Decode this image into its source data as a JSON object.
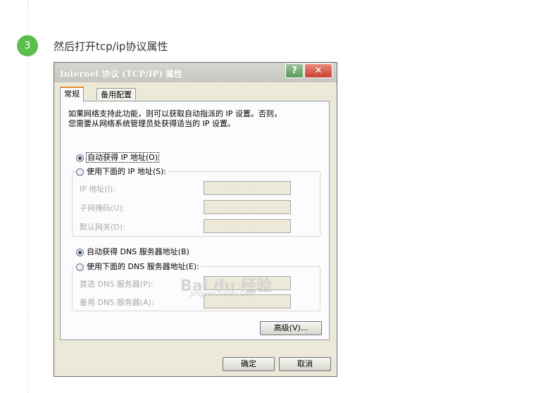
{
  "step": {
    "number": "3",
    "text": "然后打开tcp/ip协议属性"
  },
  "dialog": {
    "title": "Internet 协议 (TCP/IP) 属性",
    "help_btn": "?",
    "close_btn": "✕",
    "tabs": [
      {
        "label": "常规"
      },
      {
        "label": "备用配置"
      }
    ],
    "description_line1": "如果网络支持此功能，则可以获取自动指派的 IP 设置。否则，",
    "description_line2": "您需要从网络系统管理员处获得适当的 IP 设置。",
    "auto_ip": "自动获得 IP 地址(O)",
    "manual_ip": "使用下面的 IP 地址(S):",
    "ip_address_label": "IP 地址(I):",
    "subnet_label": "子网掩码(U):",
    "gateway_label": "默认网关(D):",
    "auto_dns": "自动获得 DNS 服务器地址(B)",
    "manual_dns": "使用下面的 DNS 服务器地址(E):",
    "preferred_dns_label": "首选 DNS 服务器(P):",
    "alternate_dns_label": "备用 DNS 服务器(A):",
    "advanced_btn": "高级(V)...",
    "ok_btn": "确定",
    "cancel_btn": "取消"
  },
  "watermark": {
    "logo": "Bai du 经验",
    "url": "jingyan.baidu.com"
  },
  "colors": {
    "step_circle": "#5bbd4b",
    "dialog_bg": "#ece9d8",
    "tab_accent": "#e68b2c"
  }
}
